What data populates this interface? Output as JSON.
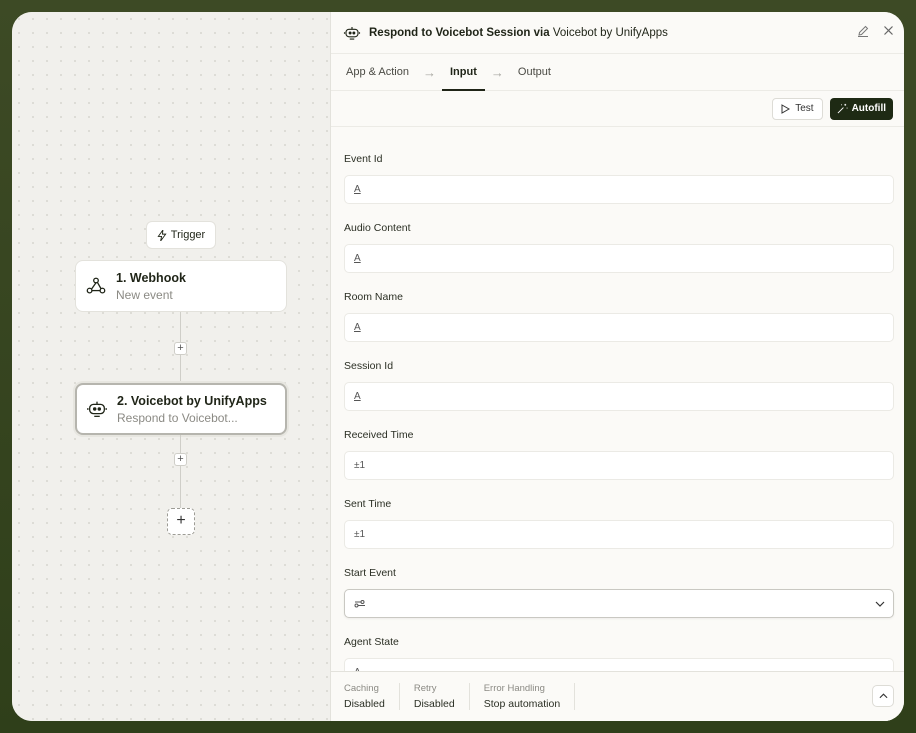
{
  "canvas": {
    "trigger_label": "Trigger",
    "nodes": [
      {
        "title": "1. Webhook",
        "subtitle": "New event"
      },
      {
        "title": "2. Voicebot by UnifyApps",
        "subtitle": "Respond to Voicebot..."
      }
    ],
    "add_step_symbol": "+"
  },
  "panel": {
    "title_prefix": "Respond to Voicebot Session via ",
    "title_app": "Voicebot by UnifyApps",
    "tabs": [
      {
        "label": "App & Action",
        "active": false
      },
      {
        "label": "Input",
        "active": true
      },
      {
        "label": "Output",
        "active": false
      }
    ],
    "toolbar": {
      "test_label": "Test",
      "autofill_label": "Autofill"
    },
    "fields": [
      {
        "label": "Event Id",
        "type_glyph": "A"
      },
      {
        "label": "Audio Content",
        "type_glyph": "A"
      },
      {
        "label": "Room Name",
        "type_glyph": "A"
      },
      {
        "label": "Session Id",
        "type_glyph": "A"
      },
      {
        "label": "Received Time",
        "type_glyph": "±1"
      },
      {
        "label": "Sent Time",
        "type_glyph": "±1"
      },
      {
        "label": "Start Event",
        "type_glyph": "select"
      },
      {
        "label": "Agent State",
        "type_glyph": "A"
      }
    ],
    "footer": {
      "caching_label": "Caching",
      "caching_value": "Disabled",
      "retry_label": "Retry",
      "retry_value": "Disabled",
      "error_label": "Error Handling",
      "error_value": "Stop automation"
    }
  },
  "colors": {
    "accent_dark": "#1e2a14",
    "outer_bg": "#3d4a25"
  }
}
